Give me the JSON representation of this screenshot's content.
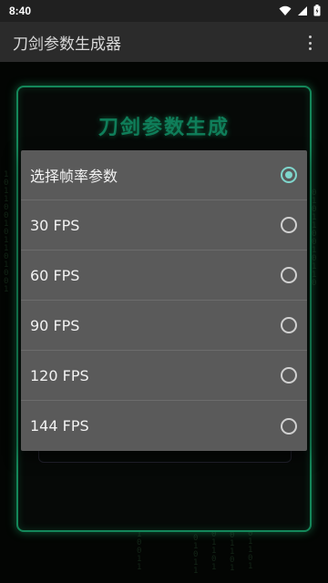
{
  "status_bar": {
    "time": "8:40"
  },
  "app_bar": {
    "title": "刀剑参数生成器"
  },
  "card": {
    "title": "刀剑参数生成"
  },
  "dialog": {
    "title": "选择帧率参数",
    "title_selected": true,
    "options": [
      {
        "label": "30 FPS",
        "selected": false
      },
      {
        "label": "60 FPS",
        "selected": false
      },
      {
        "label": "90 FPS",
        "selected": false
      },
      {
        "label": "120 FPS",
        "selected": false
      },
      {
        "label": "144 FPS",
        "selected": false
      }
    ]
  },
  "colors": {
    "accent": "#7fd6cc",
    "glow": "#1fd08a",
    "dialog_bg": "#5a5a5a"
  },
  "icons": [
    "wifi-icon",
    "signal-icon",
    "battery-icon",
    "more-vert-icon"
  ]
}
